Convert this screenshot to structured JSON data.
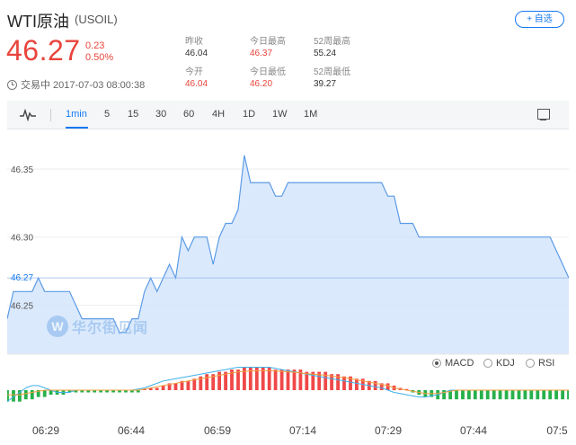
{
  "header": {
    "title": "WTI原油",
    "symbol": "(USOIL)",
    "price": "46.27",
    "change": "0.23",
    "change_pct": "0.50%",
    "time_text": "交易中 2017-07-03 08:00:38",
    "add_label": "+ 自选"
  },
  "stats": [
    {
      "label": "昨收",
      "value": "46.04",
      "red": false
    },
    {
      "label": "今日最高",
      "value": "46.37",
      "red": true
    },
    {
      "label": "52周最高",
      "value": "55.24",
      "red": false
    },
    {
      "label": "今开",
      "value": "46.04",
      "red": true
    },
    {
      "label": "今日最低",
      "value": "46.20",
      "red": true
    },
    {
      "label": "52周最低",
      "value": "39.27",
      "red": false
    }
  ],
  "toolbar": {
    "periods": [
      "1min",
      "5",
      "15",
      "30",
      "60",
      "4H",
      "1D",
      "1W",
      "1M"
    ],
    "active": "1min"
  },
  "indicators": {
    "options": [
      "MACD",
      "KDJ",
      "RSI"
    ],
    "selected": "MACD"
  },
  "watermark": {
    "text": "华尔街见闻",
    "mark": "W"
  },
  "colors": {
    "up": "#e8453c",
    "accent": "#1478f0",
    "line": "#5b9be6",
    "fill": "#cfe2fb"
  },
  "chart_data": {
    "type": "area",
    "y_ticks": [
      "46.35",
      "46.30",
      "46.25"
    ],
    "current_price_label": "46.27",
    "x_ticks": [
      "06:29",
      "06:44",
      "06:59",
      "07:14",
      "07:29",
      "07:44",
      "07:5"
    ],
    "x_range_minutes": [
      0,
      90
    ],
    "x_start_time": "06:25",
    "ylim": [
      46.214,
      46.379
    ],
    "x": [
      0,
      1,
      2,
      3,
      4,
      5,
      6,
      7,
      8,
      9,
      10,
      11,
      12,
      13,
      14,
      15,
      16,
      17,
      18,
      19,
      20,
      21,
      22,
      23,
      24,
      25,
      26,
      27,
      28,
      29,
      30,
      31,
      32,
      33,
      34,
      35,
      36,
      37,
      38,
      39,
      40,
      41,
      42,
      43,
      44,
      45,
      46,
      47,
      48,
      49,
      50,
      51,
      52,
      53,
      54,
      55,
      56,
      57,
      58,
      59,
      60,
      61,
      62,
      63,
      64,
      65,
      66,
      67,
      68,
      69,
      70,
      71,
      72,
      73,
      74,
      75,
      76,
      77,
      78,
      79,
      80,
      81,
      82,
      83,
      84,
      85,
      86,
      87,
      88,
      89,
      90
    ],
    "y": [
      46.24,
      46.26,
      46.26,
      46.26,
      46.26,
      46.27,
      46.26,
      46.26,
      46.26,
      46.26,
      46.26,
      46.25,
      46.24,
      46.24,
      46.24,
      46.24,
      46.24,
      46.24,
      46.23,
      46.23,
      46.24,
      46.24,
      46.26,
      46.27,
      46.26,
      46.27,
      46.28,
      46.27,
      46.3,
      46.29,
      46.3,
      46.3,
      46.3,
      46.28,
      46.3,
      46.31,
      46.31,
      46.32,
      46.36,
      46.34,
      46.34,
      46.34,
      46.34,
      46.33,
      46.33,
      46.34,
      46.34,
      46.34,
      46.34,
      46.34,
      46.34,
      46.34,
      46.34,
      46.34,
      46.34,
      46.34,
      46.34,
      46.34,
      46.34,
      46.34,
      46.34,
      46.33,
      46.33,
      46.31,
      46.31,
      46.31,
      46.3,
      46.3,
      46.3,
      46.3,
      46.3,
      46.3,
      46.3,
      46.3,
      46.3,
      46.3,
      46.3,
      46.3,
      46.3,
      46.3,
      46.3,
      46.3,
      46.3,
      46.3,
      46.3,
      46.3,
      46.3,
      46.3,
      46.29,
      46.28,
      46.27
    ],
    "macd": {
      "hist": [
        -0.5,
        -0.5,
        -0.5,
        -0.4,
        -0.4,
        -0.3,
        -0.3,
        -0.2,
        -0.2,
        -0.2,
        -0.1,
        -0.1,
        -0.1,
        -0.1,
        -0.1,
        -0.1,
        -0.1,
        -0.1,
        -0.1,
        -0.1,
        -0.1,
        -0.1,
        0.05,
        0.1,
        0.1,
        0.2,
        0.3,
        0.3,
        0.4,
        0.4,
        0.5,
        0.6,
        0.7,
        0.7,
        0.8,
        0.8,
        0.9,
        0.9,
        1.0,
        1.0,
        1.0,
        1.0,
        1.0,
        0.9,
        0.9,
        0.9,
        0.9,
        0.9,
        0.8,
        0.8,
        0.8,
        0.8,
        0.7,
        0.7,
        0.6,
        0.6,
        0.5,
        0.5,
        0.4,
        0.4,
        0.3,
        0.3,
        0.2,
        0.1,
        0.05,
        -0.1,
        -0.2,
        -0.3,
        -0.3,
        -0.4,
        -0.4,
        -0.4,
        -0.4,
        -0.4,
        -0.4,
        -0.4,
        -0.4,
        -0.4,
        -0.4,
        -0.4,
        -0.4,
        -0.4,
        -0.4,
        -0.4,
        -0.4,
        -0.4,
        -0.4,
        -0.4,
        -0.4,
        -0.4,
        -0.4
      ],
      "diff": [
        -0.5,
        -0.3,
        -0.1,
        0.1,
        0.2,
        0.2,
        0.1,
        0.0,
        -0.1,
        -0.1,
        -0.1,
        0.0,
        0.0,
        0.0,
        0.0,
        0.0,
        0.0,
        0.0,
        0.0,
        0.0,
        0.0,
        0.05,
        0.1,
        0.2,
        0.3,
        0.4,
        0.45,
        0.5,
        0.55,
        0.6,
        0.65,
        0.7,
        0.75,
        0.8,
        0.85,
        0.9,
        0.95,
        1.0,
        1.0,
        1.0,
        1.0,
        1.0,
        1.0,
        0.95,
        0.9,
        0.85,
        0.8,
        0.75,
        0.7,
        0.65,
        0.6,
        0.55,
        0.5,
        0.45,
        0.4,
        0.35,
        0.3,
        0.25,
        0.2,
        0.15,
        0.1,
        0.0,
        -0.1,
        -0.15,
        -0.2,
        -0.25,
        -0.3,
        -0.3,
        -0.25,
        -0.2,
        -0.1,
        0.0,
        0.0,
        0.0,
        0.0,
        0.0,
        0.0,
        0.0,
        0.0,
        0.0,
        0.0,
        0.0,
        0.0,
        0.0,
        0.0,
        0.0,
        0.0,
        0.0,
        0.0,
        0.0,
        0.0
      ],
      "dea": [
        -0.2,
        -0.2,
        -0.2,
        -0.15,
        -0.1,
        -0.05,
        0.0,
        0.0,
        0.0,
        0.0,
        0.0,
        0.0,
        0.0,
        0.0,
        0.0,
        0.0,
        0.0,
        0.0,
        0.0,
        0.0,
        0.0,
        0.0,
        0.05,
        0.1,
        0.15,
        0.2,
        0.25,
        0.3,
        0.35,
        0.4,
        0.45,
        0.5,
        0.55,
        0.6,
        0.65,
        0.7,
        0.75,
        0.8,
        0.82,
        0.84,
        0.85,
        0.85,
        0.85,
        0.84,
        0.82,
        0.8,
        0.78,
        0.75,
        0.72,
        0.7,
        0.68,
        0.65,
        0.62,
        0.58,
        0.55,
        0.5,
        0.45,
        0.4,
        0.35,
        0.3,
        0.25,
        0.2,
        0.1,
        0.05,
        0.0,
        -0.05,
        -0.1,
        -0.15,
        -0.15,
        -0.15,
        -0.1,
        -0.05,
        0.0,
        0.0,
        0.0,
        0.0,
        0.0,
        0.0,
        0.0,
        0.0,
        0.0,
        0.0,
        0.0,
        0.0,
        0.0,
        0.0,
        0.0,
        0.0,
        0.0,
        0.0,
        0.0
      ]
    }
  }
}
